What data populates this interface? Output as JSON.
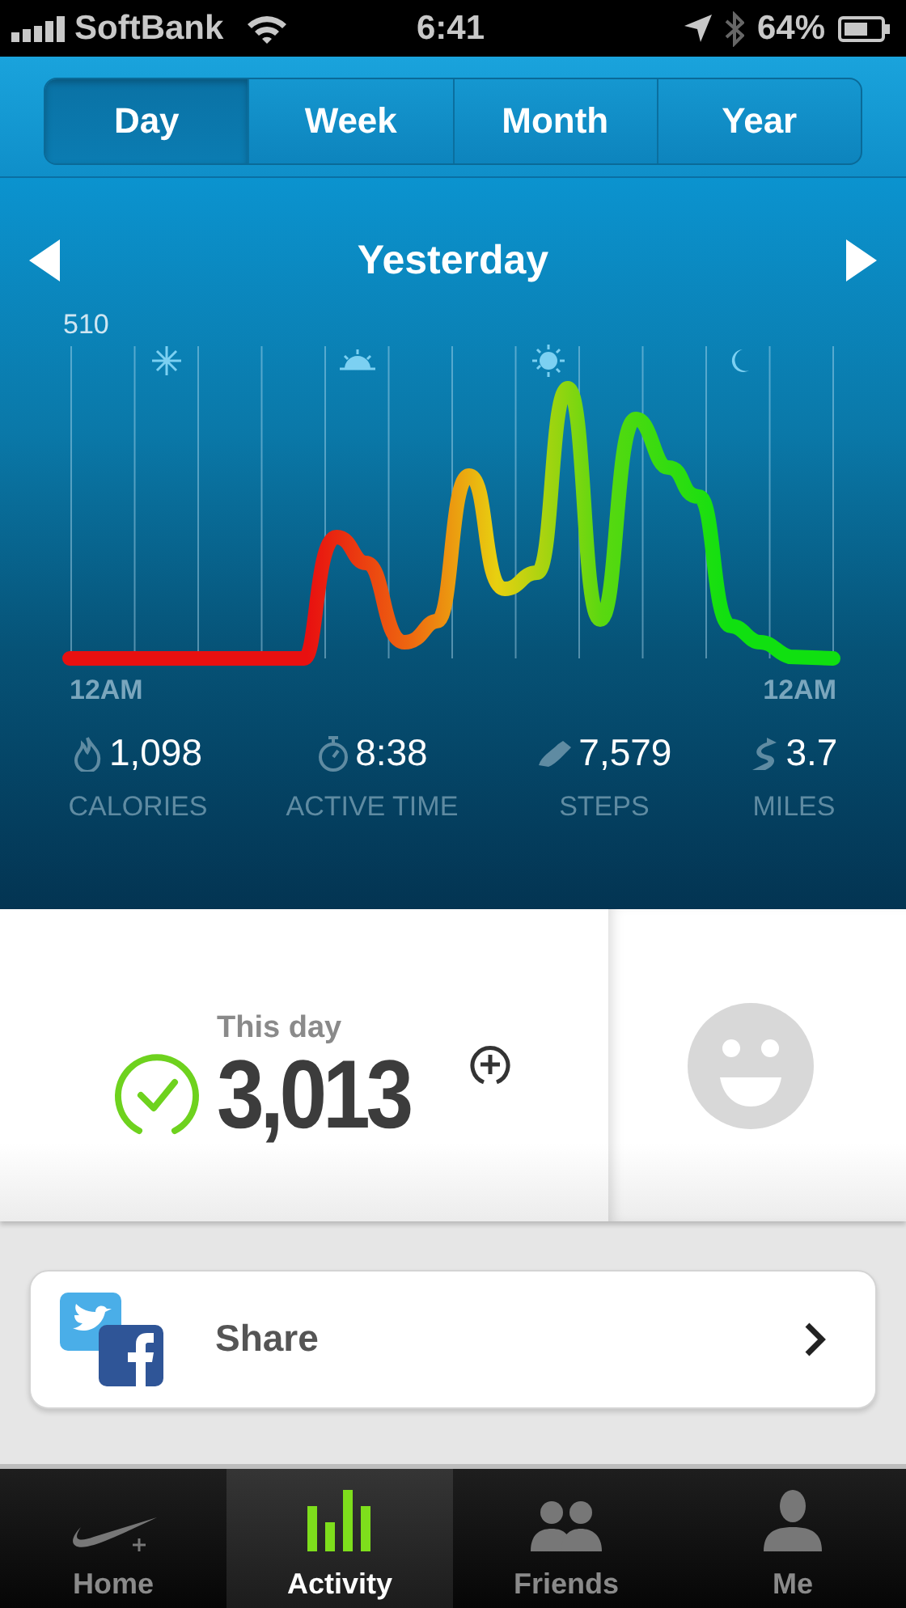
{
  "status_bar": {
    "carrier": "SoftBank",
    "time": "6:41",
    "battery": "64%"
  },
  "period_tabs": [
    {
      "label": "Day",
      "selected": true
    },
    {
      "label": "Week",
      "selected": false
    },
    {
      "label": "Month",
      "selected": false
    },
    {
      "label": "Year",
      "selected": false
    }
  ],
  "day_nav": {
    "title": "Yesterday"
  },
  "chart": {
    "y_max_label": "510",
    "x_start_label": "12AM",
    "x_end_label": "12AM"
  },
  "stats": [
    {
      "kind": "calories",
      "value": "1,098",
      "label": "CALORIES"
    },
    {
      "kind": "time",
      "value": "8:38",
      "label": "ACTIVE TIME"
    },
    {
      "kind": "steps",
      "value": "7,579",
      "label": "STEPS"
    },
    {
      "kind": "miles",
      "value": "3.7",
      "label": "MILES"
    }
  ],
  "summary": {
    "caption": "This day",
    "value": "3,013",
    "goal_met": true
  },
  "share": {
    "label": "Share"
  },
  "tab_bar": [
    {
      "kind": "home",
      "label": "Home",
      "selected": false
    },
    {
      "kind": "activity",
      "label": "Activity",
      "selected": true
    },
    {
      "kind": "friends",
      "label": "Friends",
      "selected": false
    },
    {
      "kind": "me",
      "label": "Me",
      "selected": false
    }
  ]
}
